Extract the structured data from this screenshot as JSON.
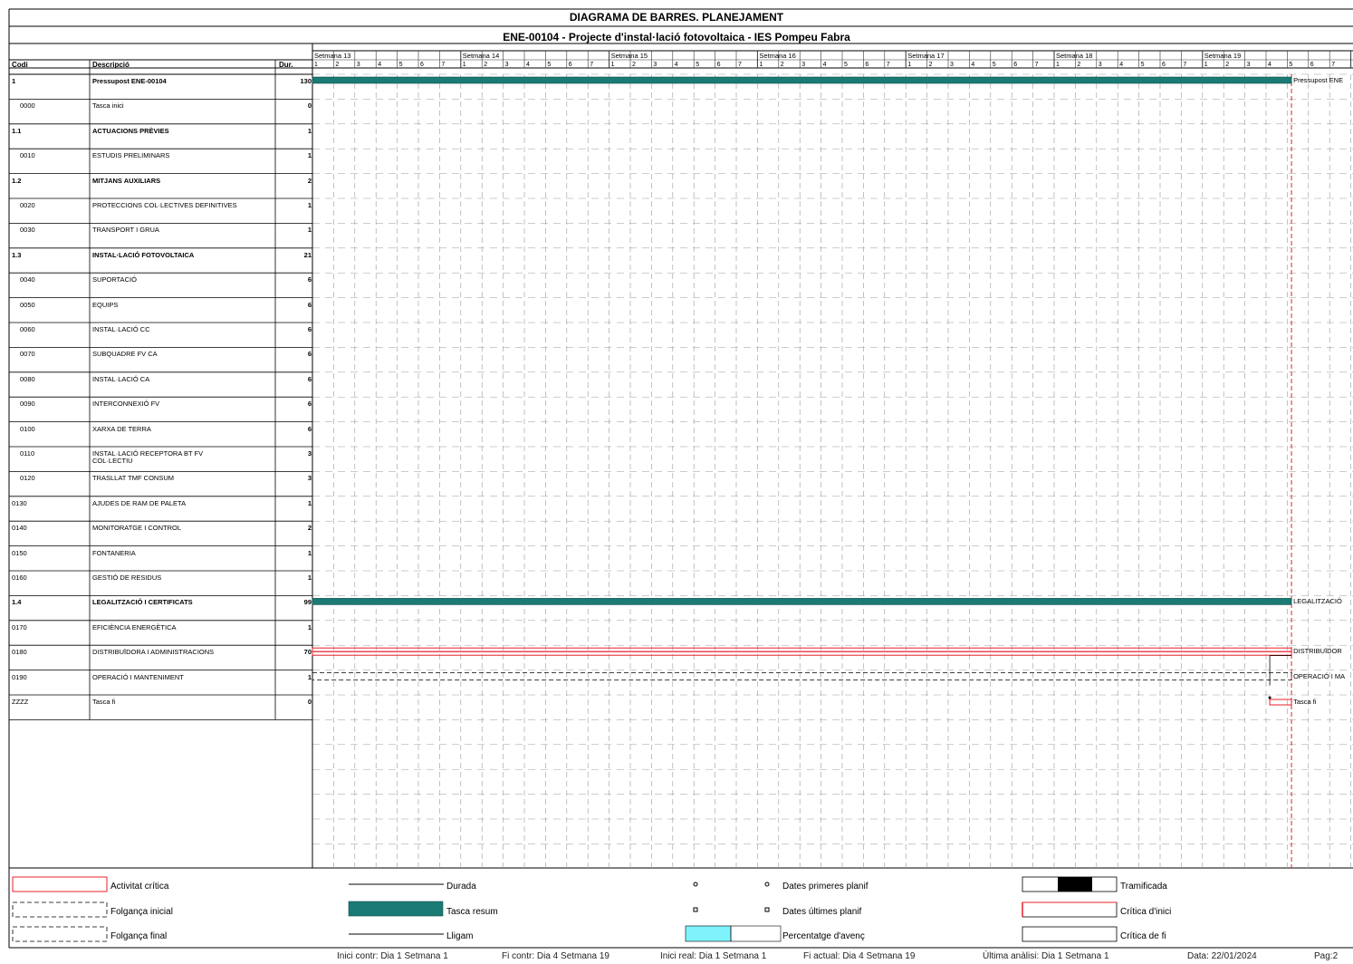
{
  "header": {
    "title": "DIAGRAMA DE BARRES. PLANEJAMENT",
    "subtitle": "ENE-00104 - Projecte d'instal·lació fotovoltaica - IES Pompeu Fabra"
  },
  "table": {
    "columns": {
      "code": "Codi",
      "description": "Descripció",
      "duration": "Dur."
    }
  },
  "colors": {
    "summary_bar": "#1a7a74",
    "critical": "#e8202a",
    "progress": "#7ff3fb",
    "grid": "#9a9a9a"
  },
  "chart_data": {
    "type": "gantt",
    "weeks": [
      "Setmana 13",
      "Setmana 14",
      "Setmana 15",
      "Setmana 16",
      "Setmana 17",
      "Setmana 18",
      "Setmana 19"
    ],
    "days": [
      "1",
      "2",
      "3",
      "4",
      "5",
      "6",
      "7"
    ],
    "extra_days": [
      "5",
      "6",
      "7"
    ],
    "tasks": [
      {
        "code": "1",
        "description": "Pressupost ENE-00104",
        "duration": "130",
        "bold": true,
        "bar": "summary",
        "end_label": "Pressupost ENE"
      },
      {
        "code": "0000",
        "description": "Tasca inici",
        "duration": "0",
        "bold": false,
        "bar": "none"
      },
      {
        "code": "1.1",
        "description": "ACTUACIONS PRÈVIES",
        "duration": "1",
        "bold": true,
        "bar": "none"
      },
      {
        "code": "0010",
        "description": "ESTUDIS PRELIMINARS",
        "duration": "1",
        "bold": false,
        "bar": "none"
      },
      {
        "code": "1.2",
        "description": "MITJANS AUXILIARS",
        "duration": "2",
        "bold": true,
        "bar": "none"
      },
      {
        "code": "0020",
        "description": "PROTECCIONS COL·LECTIVES DEFINITIVES",
        "duration": "1",
        "bold": false,
        "bar": "none"
      },
      {
        "code": "0030",
        "description": "TRANSPORT I GRUA",
        "duration": "1",
        "bold": false,
        "bar": "none"
      },
      {
        "code": "1.3",
        "description": "INSTAL·LACIÓ FOTOVOLTAICA",
        "duration": "21",
        "bold": true,
        "bar": "none"
      },
      {
        "code": "0040",
        "description": "SUPORTACIÓ",
        "duration": "6",
        "bold": false,
        "bar": "none"
      },
      {
        "code": "0050",
        "description": "EQUIPS",
        "duration": "6",
        "bold": false,
        "bar": "none"
      },
      {
        "code": "0060",
        "description": "INSTAL·LACIÓ CC",
        "duration": "6",
        "bold": false,
        "bar": "none"
      },
      {
        "code": "0070",
        "description": "SUBQUADRE FV CA",
        "duration": "6",
        "bold": false,
        "bar": "none"
      },
      {
        "code": "0080",
        "description": "INSTAL·LACIÓ CA",
        "duration": "6",
        "bold": false,
        "bar": "none"
      },
      {
        "code": "0090",
        "description": "INTERCONNEXIÓ FV",
        "duration": "6",
        "bold": false,
        "bar": "none"
      },
      {
        "code": "0100",
        "description": "XARXA DE TERRA",
        "duration": "6",
        "bold": false,
        "bar": "none"
      },
      {
        "code": "0110",
        "description": "INSTAL·LACIÓ RECEPTORA BT FV",
        "description2": "COL·LECTIU",
        "duration": "3",
        "bold": false,
        "bar": "none"
      },
      {
        "code": "0120",
        "description": "TRASLLAT TMF CONSUM",
        "duration": "3",
        "bold": false,
        "bar": "none"
      },
      {
        "code": "0130",
        "description": "AJUDES DE RAM DE PALETA",
        "duration": "1",
        "bold": false,
        "bar": "none"
      },
      {
        "code": "0140",
        "description": "MONITORATGE I CONTROL",
        "duration": "2",
        "bold": false,
        "bar": "none"
      },
      {
        "code": "0150",
        "description": "FONTANERIA",
        "duration": "1",
        "bold": false,
        "bar": "none"
      },
      {
        "code": "0160",
        "description": "GESTIÓ DE RESIDUS",
        "duration": "1",
        "bold": false,
        "bar": "none"
      },
      {
        "code": "1.4",
        "description": "LEGALITZACIÓ I CERTIFICATS",
        "duration": "99",
        "bold": true,
        "bar": "summary",
        "end_label": "LEGALITZACIÓ"
      },
      {
        "code": "0170",
        "description": "EFICIÈNCIA ENERGÈTICA",
        "duration": "1",
        "bold": false,
        "bar": "none"
      },
      {
        "code": "0180",
        "description": "DISTRIBUÏDORA I ADMINISTRACIONS",
        "duration": "70",
        "bold": false,
        "bar": "critical",
        "end_label": "DISTRIBUÏDOR"
      },
      {
        "code": "0190",
        "description": "OPERACIÓ I MANTENIMENT",
        "duration": "1",
        "bold": false,
        "bar": "slack",
        "end_label": "OPERACIÓ I MA"
      },
      {
        "code": "ZZZZ",
        "description": "Tasca fi",
        "duration": "0",
        "bold": false,
        "bar": "milestone",
        "end_label": "Tasca fi"
      }
    ],
    "current_date_line": "Setmana 19, dia 4"
  },
  "legend": {
    "critical_activity": "Activitat crítica",
    "initial_slack": "Folgança inicial",
    "final_slack": "Folgança final",
    "duration": "Durada",
    "summary_task": "Tasca resum",
    "link": "Lligam",
    "first_planned": "Dates primeres planif",
    "last_planned": "Dates últimes planif",
    "progress": "Percentatge d'avenç",
    "split": "Tramificada",
    "critical_start": "Crítica d'inici",
    "critical_end": "Crítica de fi"
  },
  "footer": {
    "contract_start": "Inici contr: Dia 1 Setmana 1",
    "contract_end": "Fi contr: Dia 4 Setmana 19",
    "actual_start": "Inici real: Dia 1 Setmana 1",
    "current_end": "Fi actual: Dia 4 Setmana 19",
    "last_analysis": "Última anàlisi: Dia 1 Setmana 1",
    "date": "Data: 22/01/2024",
    "page": "Pag:2"
  }
}
